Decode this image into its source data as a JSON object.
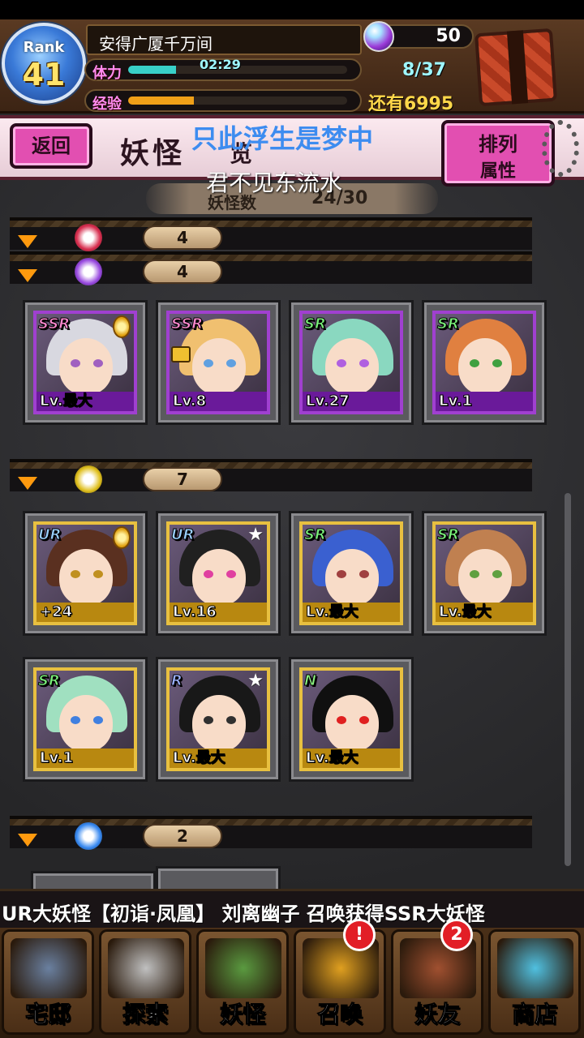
{
  "header": {
    "rank_word": "Rank",
    "rank_value": "41",
    "player_name": "安得广厦千万间",
    "stamina_label": "体力",
    "stamina_timer": "02:29",
    "stamina_value": "8/37",
    "stamina_fill_fraction": 0.22,
    "exp_label": "经验",
    "exp_fill_fraction": 0.3,
    "exp_remaining": "还有6995",
    "gems": "50"
  },
  "titlebar": {
    "back_label": "返回",
    "title": "妖怪",
    "title_extra": "览",
    "sort_line1": "排列",
    "sort_line2": "属性",
    "overlay_text_1": "只此浮生是梦中",
    "overlay_text_2": "君不见东流水",
    "count_label": "妖怪数",
    "count_value": "24/30"
  },
  "sections": [
    {
      "attr": "fire-attribute-icon",
      "count": "4"
    },
    {
      "attr": "dark-attribute-icon",
      "count": "4"
    },
    {
      "attr": "earth-attribute-icon",
      "count": "7"
    },
    {
      "attr": "water-attribute-icon",
      "count": "2"
    }
  ],
  "cards_dark": [
    {
      "rarity": "SSR",
      "level": "Lv.最大",
      "badge": "medal"
    },
    {
      "rarity": "SSR",
      "level": "Lv.8",
      "badge": "lock"
    },
    {
      "rarity": "SR",
      "level": "Lv.27",
      "badge": ""
    },
    {
      "rarity": "SR",
      "level": "Lv.1",
      "badge": ""
    }
  ],
  "cards_earth": [
    {
      "rarity": "UR",
      "level": "+24",
      "badge": "medal"
    },
    {
      "rarity": "UR",
      "level": "Lv.16",
      "badge": "star"
    },
    {
      "rarity": "SR",
      "level": "Lv.最大",
      "badge": ""
    },
    {
      "rarity": "SR",
      "level": "Lv.最大",
      "badge": ""
    },
    {
      "rarity": "SR",
      "level": "Lv.1",
      "badge": ""
    },
    {
      "rarity": "R",
      "level": "Lv.最大",
      "badge": "star"
    },
    {
      "rarity": "N",
      "level": "Lv.最大",
      "badge": ""
    }
  ],
  "ticker": "UR大妖怪【初诣·凤凰】   刘离幽子 召唤获得SSR大妖怪",
  "nav": [
    {
      "label": "宅邸",
      "badge": ""
    },
    {
      "label": "探索",
      "badge": ""
    },
    {
      "label": "妖怪",
      "badge": ""
    },
    {
      "label": "召唤",
      "badge": "!"
    },
    {
      "label": "妖友",
      "badge": "2"
    },
    {
      "label": "商店",
      "badge": ""
    }
  ],
  "colors": {
    "stamina_bar": "#38d0c8",
    "exp_bar": "#f0a018",
    "accent_pink": "#e24fb1",
    "section_triangle": "#ff9a0e"
  }
}
